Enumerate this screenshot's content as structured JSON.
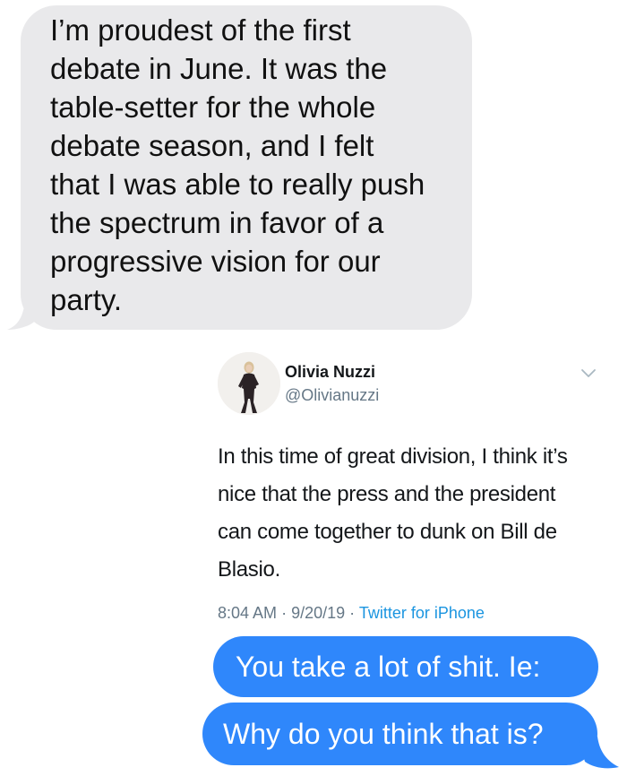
{
  "conversation": {
    "received_message": "I’m proudest of the first\ndebate in June. It was the\ntable-setter for the whole\ndebate season, and I felt\nthat I was able to really push\nthe spectrum in favor of a\nprogressive vision for our\nparty.",
    "sent_messages": [
      "You take a lot of shit. Ie:",
      "Why do you think that is?"
    ]
  },
  "tweet": {
    "author_name": "Olivia Nuzzi",
    "author_handle": "@Olivianuzzi",
    "body": "In this time of great division, I think it’s nice that the press and the president can come together to dunk on Bill de Blasio.",
    "time": "8:04 AM",
    "date": "9/20/19",
    "separator": "·",
    "source": "Twitter for iPhone",
    "menu_icon": "chevron-down-icon"
  },
  "colors": {
    "received_bubble": "#e9e9eb",
    "sent_bubble": "#2f87fb",
    "tweet_link": "#1b95e0",
    "tweet_secondary_text": "#657786"
  }
}
